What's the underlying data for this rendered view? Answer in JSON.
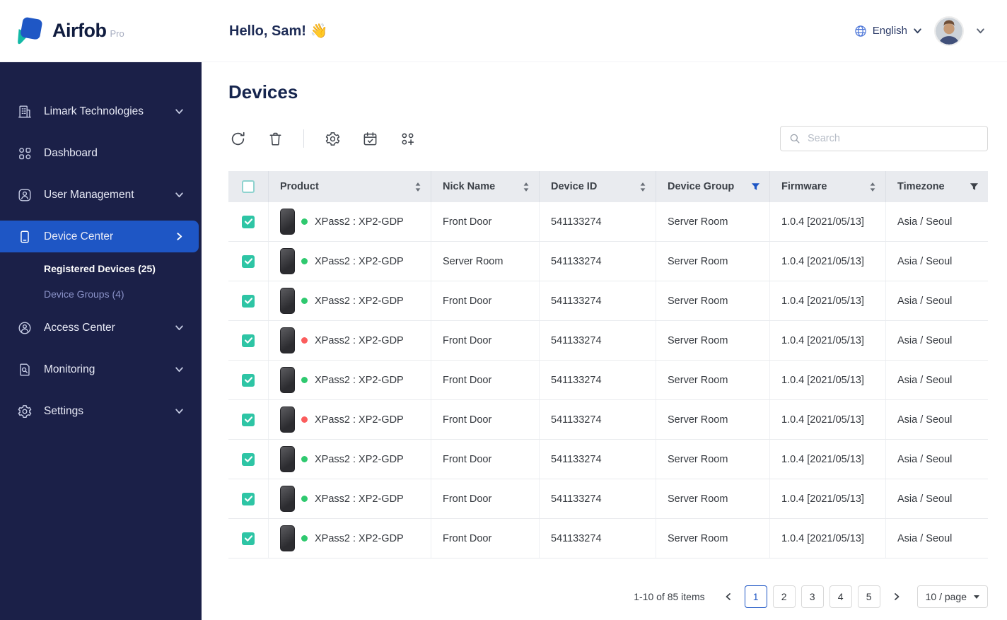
{
  "brand": {
    "name": "Airfob",
    "suffix": "Pro"
  },
  "header": {
    "greeting": "Hello, Sam! 👋",
    "language": "English"
  },
  "sidebar": {
    "items": [
      {
        "label": "Limark Technologies",
        "icon": "building-icon",
        "chevron": "down"
      },
      {
        "label": "Dashboard",
        "icon": "dashboard-icon",
        "chevron": "none"
      },
      {
        "label": "User Management",
        "icon": "user-icon",
        "chevron": "down"
      },
      {
        "label": "Device Center",
        "icon": "device-icon",
        "chevron": "right",
        "active": true
      },
      {
        "label": "Access Center",
        "icon": "access-icon",
        "chevron": "down"
      },
      {
        "label": "Monitoring",
        "icon": "monitoring-icon",
        "chevron": "down"
      },
      {
        "label": "Settings",
        "icon": "gear-icon",
        "chevron": "down"
      }
    ],
    "device_center_children": [
      {
        "label": "Registered Devices (25)",
        "selected": true
      },
      {
        "label": "Device Groups (4)",
        "selected": false
      }
    ]
  },
  "main": {
    "title": "Devices",
    "toolbar": {
      "buttons": [
        {
          "icon": "refresh-icon"
        },
        {
          "icon": "trash-icon"
        },
        {
          "icon": "firmware-gear-icon"
        },
        {
          "icon": "calendar-check-icon"
        },
        {
          "icon": "add-group-icon"
        }
      ]
    },
    "search": {
      "placeholder": "Search"
    },
    "table": {
      "columns": [
        {
          "label": "Product",
          "icon": "sort"
        },
        {
          "label": "Nick Name",
          "icon": "sort"
        },
        {
          "label": "Device ID",
          "icon": "sort"
        },
        {
          "label": "Device Group",
          "icon": "filter-active"
        },
        {
          "label": "Firmware",
          "icon": "sort"
        },
        {
          "label": "Timezone",
          "icon": "filter"
        }
      ],
      "rows": [
        {
          "checked": true,
          "status": "green",
          "product": "XPass2 : XP2-GDP",
          "nickname": "Front Door",
          "device_id": "541133274",
          "device_group": "Server Room",
          "firmware": "1.0.4 [2021/05/13]",
          "timezone": "Asia / Seoul"
        },
        {
          "checked": true,
          "status": "green",
          "product": "XPass2 : XP2-GDP",
          "nickname": "Server Room",
          "device_id": "541133274",
          "device_group": "Server Room",
          "firmware": "1.0.4 [2021/05/13]",
          "timezone": "Asia / Seoul"
        },
        {
          "checked": true,
          "status": "green",
          "product": "XPass2 : XP2-GDP",
          "nickname": "Front Door",
          "device_id": "541133274",
          "device_group": "Server Room",
          "firmware": "1.0.4 [2021/05/13]",
          "timezone": "Asia / Seoul"
        },
        {
          "checked": true,
          "status": "red",
          "product": "XPass2 : XP2-GDP",
          "nickname": "Front Door",
          "device_id": "541133274",
          "device_group": "Server Room",
          "firmware": "1.0.4 [2021/05/13]",
          "timezone": "Asia / Seoul"
        },
        {
          "checked": true,
          "status": "green",
          "product": "XPass2 : XP2-GDP",
          "nickname": "Front Door",
          "device_id": "541133274",
          "device_group": "Server Room",
          "firmware": "1.0.4 [2021/05/13]",
          "timezone": "Asia / Seoul"
        },
        {
          "checked": true,
          "status": "red",
          "product": "XPass2 : XP2-GDP",
          "nickname": "Front Door",
          "device_id": "541133274",
          "device_group": "Server Room",
          "firmware": "1.0.4 [2021/05/13]",
          "timezone": "Asia / Seoul"
        },
        {
          "checked": true,
          "status": "green",
          "product": "XPass2 : XP2-GDP",
          "nickname": "Front Door",
          "device_id": "541133274",
          "device_group": "Server Room",
          "firmware": "1.0.4 [2021/05/13]",
          "timezone": "Asia / Seoul"
        },
        {
          "checked": true,
          "status": "green",
          "product": "XPass2 : XP2-GDP",
          "nickname": "Front Door",
          "device_id": "541133274",
          "device_group": "Server Room",
          "firmware": "1.0.4 [2021/05/13]",
          "timezone": "Asia / Seoul"
        },
        {
          "checked": true,
          "status": "green",
          "product": "XPass2 : XP2-GDP",
          "nickname": "Front Door",
          "device_id": "541133274",
          "device_group": "Server Room",
          "firmware": "1.0.4 [2021/05/13]",
          "timezone": "Asia / Seoul"
        }
      ]
    },
    "pagination": {
      "summary": "1-10 of 85 items",
      "pages": [
        "1",
        "2",
        "3",
        "4",
        "5"
      ],
      "active_page": "1",
      "page_size_label": "10 / page"
    }
  },
  "colors": {
    "sidebar_bg": "#1b2048",
    "active_nav_blue": "#1e56c5",
    "accent_blue": "#1e56c5",
    "checkbox_teal": "#2ec5a5",
    "status_green": "#2fc96f",
    "status_red": "#fb5d5d",
    "logo_blue": "#1f57c5",
    "logo_teal": "#13b9a6",
    "table_header_bg": "#e9ebef"
  }
}
